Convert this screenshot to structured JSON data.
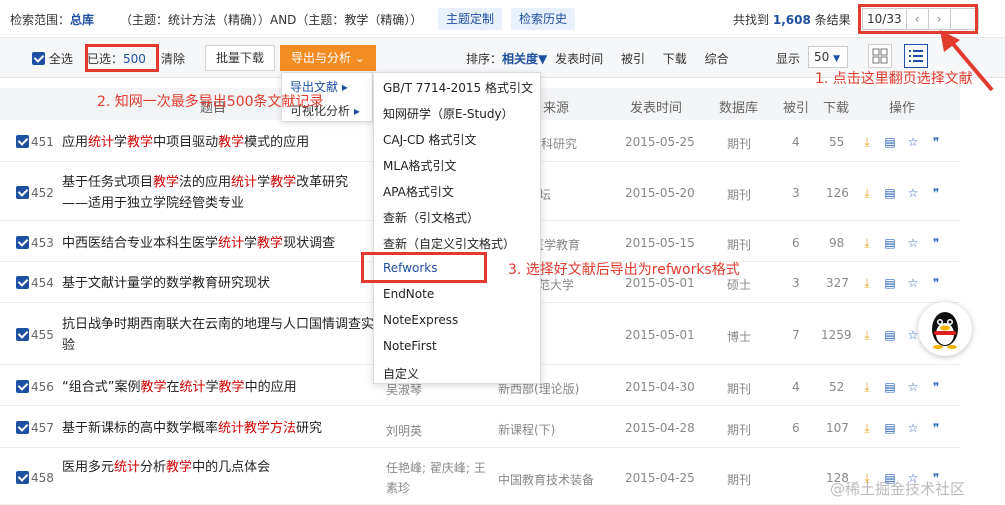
{
  "search": {
    "scope_label": "检索范围：",
    "scope_value": "总库",
    "query": "（主题：统计方法（精确））AND（主题：教学（精确））",
    "custom_topic_label": "主题定制",
    "history_label": "检索历史",
    "found_prefix": "共找到",
    "found_count": "1,608",
    "found_suffix": "条结果",
    "page_display": "10/33",
    "prev_icon": "‹",
    "next_icon": "›"
  },
  "toolbar": {
    "select_all": "全选",
    "selected_label": "已选：",
    "selected_count": "500",
    "clear": "清除",
    "batch_download": "批量下载",
    "export_analysis": "导出与分析",
    "sort_label": "排序：",
    "sort_relevance": "相关度",
    "sort_date": "发表时间",
    "sort_cited": "被引",
    "sort_downloads": "下载",
    "sort_composite": "综合",
    "show_label": "显示",
    "show_value": "50"
  },
  "table": {
    "headers": {
      "title": "题目",
      "source": "来源",
      "date": "发表时间",
      "db": "数据库",
      "cited": "被引",
      "downloads": "下载",
      "actions": "操作"
    },
    "rows": [
      {
        "num": "451",
        "title_parts": [
          [
            "应用",
            ""
          ],
          [
            "统计",
            "hl"
          ],
          [
            "学",
            ""
          ],
          [
            "教学",
            "hl"
          ],
          [
            "中项目驱动",
            ""
          ],
          [
            "教学",
            "hl"
          ],
          [
            "模式的应用",
            ""
          ]
        ],
        "author": "",
        "source": "科研究",
        "date": "2015-05-25",
        "db": "期刊",
        "cited": "4",
        "downloads": "55"
      },
      {
        "num": "452",
        "title_parts": [
          [
            "基于任务式项目",
            ""
          ],
          [
            "教学",
            "hl"
          ],
          [
            "法的应用",
            ""
          ],
          [
            "统计",
            "hl"
          ],
          [
            "学",
            ""
          ],
          [
            "教学",
            "hl"
          ],
          [
            "改革研究——适用于独立学院经管类专业",
            ""
          ]
        ],
        "author": "",
        "source": "学论坛",
        "date": "2015-05-20",
        "db": "期刊",
        "cited": "3",
        "downloads": "126"
      },
      {
        "num": "453",
        "title_parts": [
          [
            "中西医结合专业本科生医学",
            ""
          ],
          [
            "统计",
            "hl"
          ],
          [
            "学",
            ""
          ],
          [
            "教学",
            "hl"
          ],
          [
            "现状调查",
            ""
          ]
        ],
        "author": "",
        "source": "医学教育",
        "date": "2015-05-15",
        "db": "期刊",
        "cited": "6",
        "downloads": "98"
      },
      {
        "num": "454",
        "title_parts": [
          [
            "基于文献计量学的数学教育研究现状",
            ""
          ]
        ],
        "author": "",
        "source": "范大学",
        "date": "2015-05-01",
        "db": "硕士",
        "cited": "3",
        "downloads": "327"
      },
      {
        "num": "455",
        "title_parts": [
          [
            "抗日战争时期西南联大在云南的地理与人口国情调查实验",
            ""
          ]
        ],
        "author": "",
        "source": "学",
        "date": "2015-05-01",
        "db": "博士",
        "cited": "7",
        "downloads": "1259"
      },
      {
        "num": "456",
        "title_parts": [
          [
            "“组合式”案例",
            ""
          ],
          [
            "教学",
            "hl"
          ],
          [
            "在",
            ""
          ],
          [
            "统计",
            "hl"
          ],
          [
            "学",
            ""
          ],
          [
            "教学",
            "hl"
          ],
          [
            "中的应用",
            ""
          ]
        ],
        "author": "吴淑琴",
        "source": "新西部(理论版)",
        "date": "2015-04-30",
        "db": "期刊",
        "cited": "4",
        "downloads": "52"
      },
      {
        "num": "457",
        "title_parts": [
          [
            "基于新课标的高中数学概率",
            ""
          ],
          [
            "统计教学方法",
            "hl"
          ],
          [
            "研究",
            ""
          ]
        ],
        "author": "刘明英",
        "source": "新课程(下)",
        "date": "2015-04-28",
        "db": "期刊",
        "cited": "6",
        "downloads": "107"
      },
      {
        "num": "458",
        "title_parts": [
          [
            "医用多元",
            ""
          ],
          [
            "统计",
            "hl"
          ],
          [
            "分析",
            ""
          ],
          [
            "教学",
            "hl"
          ],
          [
            "中的几点体会",
            ""
          ]
        ],
        "author": "任艳峰; 翟庆峰; 王素珍",
        "source": "中国教育技术装备",
        "date": "2015-04-25",
        "db": "期刊",
        "cited": "",
        "downloads": "128"
      }
    ]
  },
  "menu": {
    "submenu": [
      "导出文献",
      "可视化分析"
    ],
    "submenu_arrow": "▸",
    "export_items": [
      "GB/T 7714-2015 格式引文",
      "知网研学（原E-Study）",
      "CAJ-CD 格式引文",
      "MLA格式引文",
      "APA格式引文",
      "查新（引文格式）",
      "查新（自定义引文格式）",
      "Refworks",
      "EndNote",
      "NoteExpress",
      "NoteFirst",
      "自定义"
    ]
  },
  "annotations": {
    "a1": "1. 点击这里翻页选择文献",
    "a2": "2. 知网一次最多导出500条文献记录",
    "a3": "3. 选择好文献后导出为refworks格式"
  },
  "watermark": "@稀土掘金技术社区",
  "colors": {
    "accent": "#1e50a2",
    "highlight": "#d40000",
    "annotation": "#e23b2e",
    "export_button": "#f28c23"
  }
}
